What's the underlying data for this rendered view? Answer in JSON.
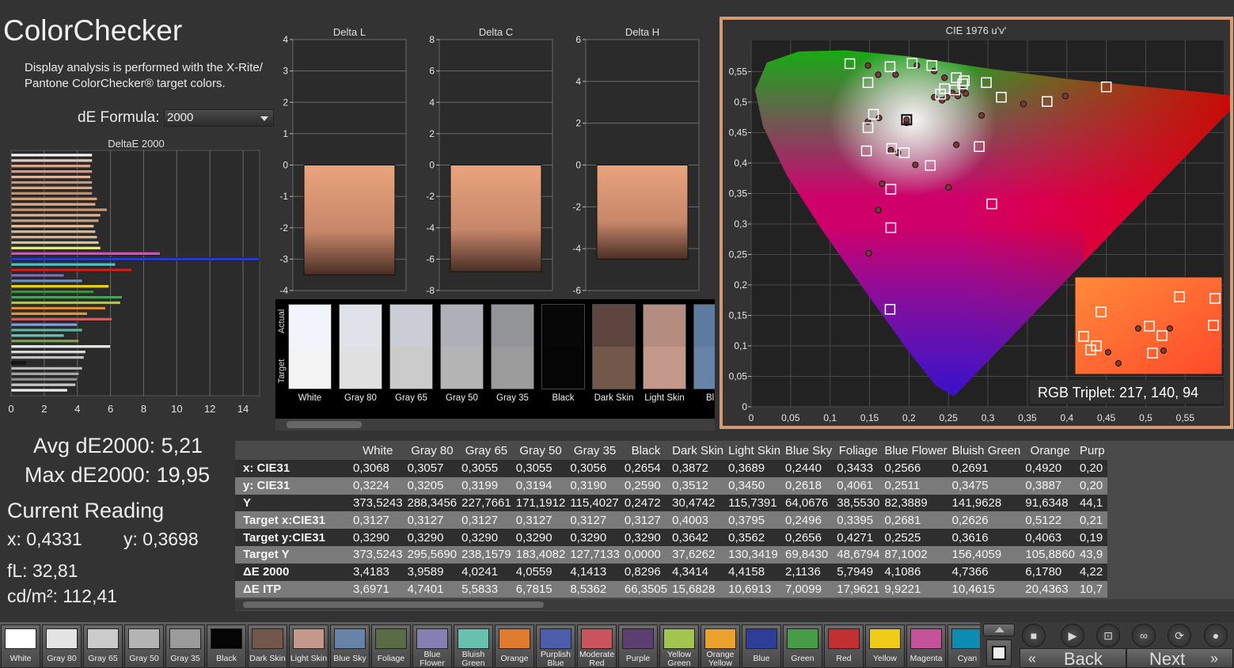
{
  "app": {
    "title": "ColorChecker",
    "description": "Display analysis is performed with the X-Rite/ Pantone ColorChecker® target colors.",
    "formula_label": "dE Formula:",
    "formula_value": "2000"
  },
  "stats": {
    "avg": "Avg dE2000: 5,21",
    "max": "Max dE2000: 19,95",
    "current_reading_label": "Current Reading",
    "x": "x: 0,4331",
    "y": "y: 0,3698",
    "fl": "fL: 32,81",
    "cdm2": "cd/m²: 112,41"
  },
  "deltae_chart": {
    "title": "DeltaE 2000",
    "ticks": [
      "0",
      "2",
      "4",
      "6",
      "8",
      "10",
      "12",
      "14"
    ],
    "bars": [
      {
        "value": 4.9,
        "color": "#f3f3f3"
      },
      {
        "value": 4.9,
        "color": "#e0c7bb"
      },
      {
        "value": 4.8,
        "color": "#dca48e"
      },
      {
        "value": 4.9,
        "color": "#d29b7a"
      },
      {
        "value": 4.8,
        "color": "#e1b39a"
      },
      {
        "value": 4.9,
        "color": "#c8987a"
      },
      {
        "value": 4.9,
        "color": "#d7aa8c"
      },
      {
        "value": 4.9,
        "color": "#c48f6c"
      },
      {
        "value": 5.2,
        "color": "#d5a07d"
      },
      {
        "value": 5.1,
        "color": "#d8a98c"
      },
      {
        "value": 5.8,
        "color": "#c69572"
      },
      {
        "value": 5.4,
        "color": "#d8b393"
      },
      {
        "value": 5.3,
        "color": "#c7a07f"
      },
      {
        "value": 5.0,
        "color": "#e8bc98"
      },
      {
        "value": 5.1,
        "color": "#d6b28f"
      },
      {
        "value": 5.2,
        "color": "#ccb69c"
      },
      {
        "value": 5.3,
        "color": "#d3c2a7"
      },
      {
        "value": 5.4,
        "color": "#e7e57d"
      },
      {
        "value": 9.0,
        "color": "#d64fc0"
      },
      {
        "value": 15.0,
        "color": "#2a3ad0"
      },
      {
        "value": 6.3,
        "color": "#45c5c9"
      },
      {
        "value": 7.3,
        "color": "#d22020"
      },
      {
        "value": 3.2,
        "color": "#7e6dbd"
      },
      {
        "value": 4.3,
        "color": "#6a8fc8"
      },
      {
        "value": 5.9,
        "color": "#e9d01e"
      },
      {
        "value": 5.0,
        "color": "#2e9a30"
      },
      {
        "value": 6.7,
        "color": "#4aa25b"
      },
      {
        "value": 6.6,
        "color": "#a7c943"
      },
      {
        "value": 5.7,
        "color": "#dc8b33"
      },
      {
        "value": 4.6,
        "color": "#de9540"
      },
      {
        "value": 6.1,
        "color": "#cf5f5f"
      },
      {
        "value": 4.0,
        "color": "#7d9edf"
      },
      {
        "value": 4.3,
        "color": "#5fb5a0"
      },
      {
        "value": 3.2,
        "color": "#76bdb0"
      },
      {
        "value": 4.1,
        "color": "#859e5a"
      },
      {
        "value": 6.0,
        "color": "#e7e7e7"
      },
      {
        "value": 4.5,
        "color": "#d7d7d7"
      },
      {
        "value": 4.4,
        "color": "#c3c3c3"
      },
      {
        "value": 0.9,
        "color": "#151515"
      },
      {
        "value": 4.3,
        "color": "#b9b9b9"
      },
      {
        "value": 4.1,
        "color": "#a5a5a5"
      },
      {
        "value": 4.0,
        "color": "#8f8f8f"
      },
      {
        "value": 3.9,
        "color": "#c6c6c6"
      },
      {
        "value": 3.4,
        "color": "#ededed"
      }
    ]
  },
  "delta_charts": [
    {
      "title": "Delta L",
      "ticks": [
        "4",
        "3",
        "2",
        "1",
        "0",
        "-1",
        "-2",
        "-3",
        "-4"
      ],
      "ymax": 4,
      "ymin": -4,
      "value": -3.5
    },
    {
      "title": "Delta C",
      "ticks": [
        "8",
        "6",
        "4",
        "2",
        "0",
        "-2",
        "-4",
        "-6",
        "-8"
      ],
      "ymax": 8,
      "ymin": -8,
      "value": -6.8
    },
    {
      "title": "Delta H",
      "ticks": [
        "6",
        "4",
        "2",
        "0",
        "-2",
        "-4",
        "-6"
      ],
      "ymax": 6,
      "ymin": -6,
      "value": -4.5
    }
  ],
  "swatch_strip": {
    "actual_label": "Actual",
    "target_label": "Target",
    "items": [
      {
        "label": "White",
        "actual": "#f2f4fb",
        "target": "#f3f3f3"
      },
      {
        "label": "Gray 80",
        "actual": "#e0e2ea",
        "target": "#e0e0e0"
      },
      {
        "label": "Gray 65",
        "actual": "#cacdd6",
        "target": "#cbcbcb"
      },
      {
        "label": "Gray 50",
        "actual": "#adb0b7",
        "target": "#b4b4b4"
      },
      {
        "label": "Gray 35",
        "actual": "#929497",
        "target": "#9b9b9b"
      },
      {
        "label": "Black",
        "actual": "#070708",
        "target": "#050505"
      },
      {
        "label": "Dark Skin",
        "actual": "#5e4540",
        "target": "#73574b"
      },
      {
        "label": "Light Skin",
        "actual": "#b58c80",
        "target": "#c4988a"
      },
      {
        "label": "Blue",
        "actual": "#5d7aa0",
        "target": "#6783a8"
      }
    ]
  },
  "cie": {
    "title": "CIE 1976 u'v'",
    "x_ticks": [
      "0",
      "0,05",
      "0,1",
      "0,15",
      "0,2",
      "0,25",
      "0,3",
      "0,35",
      "0,4",
      "0,45",
      "0,5",
      "0,55"
    ],
    "y_ticks": [
      "0",
      "0,05",
      "0,1",
      "0,15",
      "0,2",
      "0,25",
      "0,3",
      "0,35",
      "0,4",
      "0,45",
      "0,5",
      "0,55"
    ],
    "rgb_triplet": "RGB Triplet: 217, 140, 94",
    "targets": [
      [
        0.125,
        0.563
      ],
      [
        0.148,
        0.532
      ],
      [
        0.176,
        0.558
      ],
      [
        0.204,
        0.564
      ],
      [
        0.229,
        0.56
      ],
      [
        0.26,
        0.54
      ],
      [
        0.298,
        0.532
      ],
      [
        0.155,
        0.48
      ],
      [
        0.148,
        0.458
      ],
      [
        0.196,
        0.471
      ],
      [
        0.146,
        0.42
      ],
      [
        0.178,
        0.424
      ],
      [
        0.194,
        0.417
      ],
      [
        0.227,
        0.396
      ],
      [
        0.177,
        0.357
      ],
      [
        0.177,
        0.294
      ],
      [
        0.176,
        0.16
      ],
      [
        0.317,
        0.508
      ],
      [
        0.375,
        0.501
      ],
      [
        0.45,
        0.525
      ],
      [
        0.289,
        0.427
      ],
      [
        0.305,
        0.333
      ],
      [
        0.268,
        0.53
      ],
      [
        0.27,
        0.535
      ],
      [
        0.258,
        0.52
      ],
      [
        0.245,
        0.522
      ],
      [
        0.24,
        0.513
      ]
    ],
    "actuals": [
      [
        0.148,
        0.56
      ],
      [
        0.161,
        0.545
      ],
      [
        0.183,
        0.545
      ],
      [
        0.21,
        0.56
      ],
      [
        0.232,
        0.551
      ],
      [
        0.245,
        0.54
      ],
      [
        0.268,
        0.52
      ],
      [
        0.262,
        0.51
      ],
      [
        0.255,
        0.515
      ],
      [
        0.248,
        0.508
      ],
      [
        0.232,
        0.508
      ],
      [
        0.242,
        0.503
      ],
      [
        0.272,
        0.514
      ],
      [
        0.292,
        0.478
      ],
      [
        0.345,
        0.497
      ],
      [
        0.398,
        0.51
      ],
      [
        0.162,
        0.474
      ],
      [
        0.148,
        0.468
      ],
      [
        0.197,
        0.466
      ],
      [
        0.177,
        0.421
      ],
      [
        0.186,
        0.417
      ],
      [
        0.208,
        0.397
      ],
      [
        0.26,
        0.43
      ],
      [
        0.25,
        0.36
      ],
      [
        0.166,
        0.366
      ],
      [
        0.161,
        0.323
      ],
      [
        0.149,
        0.252
      ],
      [
        0.197,
        0.471
      ]
    ]
  },
  "table": {
    "columns": [
      "White",
      "Gray 80",
      "Gray 65",
      "Gray 50",
      "Gray 35",
      "Black",
      "Dark Skin",
      "Light Skin",
      "Blue Sky",
      "Foliage",
      "Blue Flower",
      "Bluish Green",
      "Orange",
      "Purp"
    ],
    "rows": [
      {
        "label": "x: CIE31",
        "cells": [
          "0,3068",
          "0,3057",
          "0,3055",
          "0,3055",
          "0,3056",
          "0,2654",
          "0,3872",
          "0,3689",
          "0,2440",
          "0,3433",
          "0,2566",
          "0,2691",
          "0,4920",
          "0,20"
        ]
      },
      {
        "label": "y: CIE31",
        "cells": [
          "0,3224",
          "0,3205",
          "0,3199",
          "0,3194",
          "0,3190",
          "0,2590",
          "0,3512",
          "0,3450",
          "0,2618",
          "0,4061",
          "0,2511",
          "0,3475",
          "0,3887",
          "0,20"
        ]
      },
      {
        "label": "Y",
        "cells": [
          "373,5243",
          "288,3456",
          "227,7661",
          "171,1912",
          "115,4027",
          "0,2472",
          "30,4742",
          "115,7391",
          "64,0676",
          "38,5530",
          "82,3889",
          "141,9628",
          "91,6348",
          "44,1"
        ]
      },
      {
        "label": "Target x:CIE31",
        "cells": [
          "0,3127",
          "0,3127",
          "0,3127",
          "0,3127",
          "0,3127",
          "0,3127",
          "0,4003",
          "0,3795",
          "0,2496",
          "0,3395",
          "0,2681",
          "0,2626",
          "0,5122",
          "0,21"
        ]
      },
      {
        "label": "Target y:CIE31",
        "cells": [
          "0,3290",
          "0,3290",
          "0,3290",
          "0,3290",
          "0,3290",
          "0,3290",
          "0,3642",
          "0,3562",
          "0,2656",
          "0,4271",
          "0,2525",
          "0,3616",
          "0,4063",
          "0,19"
        ]
      },
      {
        "label": "Target Y",
        "cells": [
          "373,5243",
          "295,5690",
          "238,1579",
          "183,4082",
          "127,7133",
          "0,0000",
          "37,6262",
          "130,3419",
          "69,8430",
          "48,6794",
          "87,1002",
          "156,4059",
          "105,8860",
          "43,9"
        ]
      },
      {
        "label": "ΔE 2000",
        "cells": [
          "3,4183",
          "3,9589",
          "4,0241",
          "4,0559",
          "4,1413",
          "0,8296",
          "4,3414",
          "4,4158",
          "2,1136",
          "5,7949",
          "4,1086",
          "4,7366",
          "6,1780",
          "4,22"
        ]
      },
      {
        "label": "ΔE ITP",
        "cells": [
          "3,6971",
          "4,7401",
          "5,5833",
          "6,7815",
          "8,5362",
          "66,3505",
          "15,6828",
          "10,6913",
          "7,0099",
          "17,9621",
          "9,9221",
          "10,4615",
          "20,4363",
          "10,7"
        ]
      }
    ]
  },
  "patches": [
    {
      "label": "White",
      "color": "#ffffff"
    },
    {
      "label": "Gray 80",
      "color": "#e4e4e4"
    },
    {
      "label": "Gray 65",
      "color": "#cbcbcb"
    },
    {
      "label": "Gray 50",
      "color": "#b4b4b4"
    },
    {
      "label": "Gray 35",
      "color": "#9b9b9b"
    },
    {
      "label": "Black",
      "color": "#050505"
    },
    {
      "label": "Dark Skin",
      "color": "#73574b"
    },
    {
      "label": "Light Skin",
      "color": "#c4988a"
    },
    {
      "label": "Blue Sky",
      "color": "#6783a8"
    },
    {
      "label": "Foliage",
      "color": "#5a6c45"
    },
    {
      "label": "Blue Flower",
      "color": "#8580b2"
    },
    {
      "label": "Bluish Green",
      "color": "#68c0ae"
    },
    {
      "label": "Orange",
      "color": "#df7b2c"
    },
    {
      "label": "Purplish Blue",
      "color": "#4e5cac"
    },
    {
      "label": "Moderate Red",
      "color": "#c9545e"
    },
    {
      "label": "Purple",
      "color": "#5c3f70"
    },
    {
      "label": "Yellow Green",
      "color": "#a4c450"
    },
    {
      "label": "Orange Yellow",
      "color": "#eaa22c"
    },
    {
      "label": "Blue",
      "color": "#2d3d98"
    },
    {
      "label": "Green",
      "color": "#479c48"
    },
    {
      "label": "Red",
      "color": "#c23033"
    },
    {
      "label": "Yellow",
      "color": "#f0cc18"
    },
    {
      "label": "Magenta",
      "color": "#c5539a"
    },
    {
      "label": "Cyan",
      "color": "#0b8cb0"
    }
  ],
  "nav": {
    "back": "Back",
    "next": "Next"
  }
}
